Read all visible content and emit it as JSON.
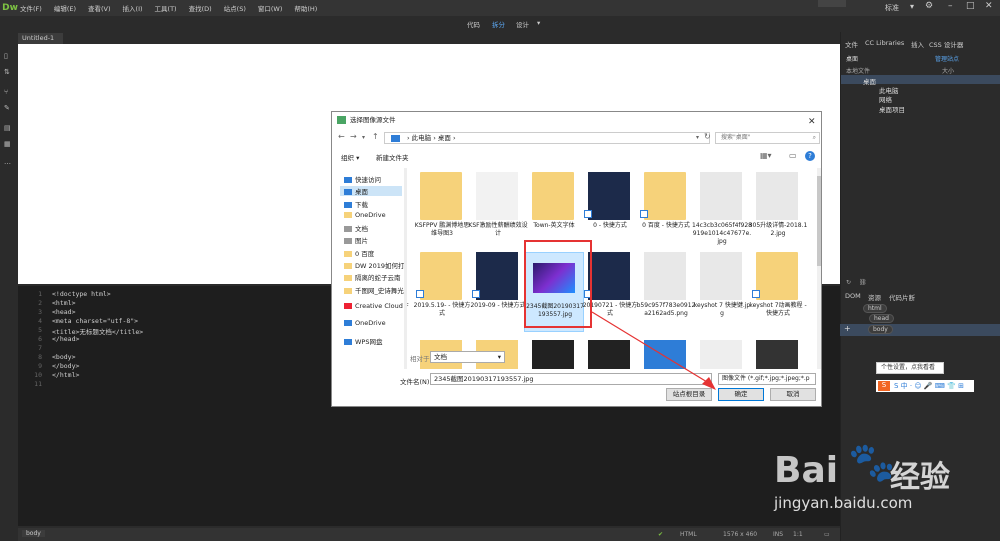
{
  "app": {
    "logo": "Dw",
    "menus": [
      "文件(F)",
      "编辑(E)",
      "查看(V)",
      "插入(I)",
      "工具(T)",
      "查找(D)",
      "站点(S)",
      "窗口(W)",
      "帮助(H)"
    ],
    "workspace": "标准",
    "view_buttons": [
      "代码",
      "拆分",
      "设计"
    ],
    "doc_tab": "Untitled-1",
    "doc_tab_close": "×"
  },
  "code": {
    "lines": [
      {
        "n": "1",
        "text": "<!doctype html>"
      },
      {
        "n": "2",
        "text": "<html>"
      },
      {
        "n": "3",
        "text": "<head>"
      },
      {
        "n": "4",
        "text": "<meta charset=\"utf-8\">"
      },
      {
        "n": "5",
        "text": "<title>无标题文档</title>"
      },
      {
        "n": "6",
        "text": "</head>"
      },
      {
        "n": "7",
        "text": ""
      },
      {
        "n": "8",
        "text": "<body>"
      },
      {
        "n": "9",
        "text": "</body>"
      },
      {
        "n": "10",
        "text": "</html>"
      },
      {
        "n": "11",
        "text": ""
      }
    ]
  },
  "statusbar": {
    "tag": "body",
    "lang": "HTML",
    "size": "1576 x 460",
    "mode": "INS",
    "pos": "1:1"
  },
  "rightpanel": {
    "tabs": [
      "文件",
      "CC Libraries",
      "插入",
      "CSS 设计器"
    ],
    "location": "桌面",
    "manage": "管理站点",
    "local_files": "本地文件",
    "size_col": "大小",
    "tree": [
      "桌面",
      "此电脑",
      "网络",
      "桌面项目"
    ],
    "dom_tabs": [
      "DOM",
      "资源",
      "代码片断"
    ],
    "dom_nodes": [
      "html",
      "head",
      "body"
    ]
  },
  "dialog": {
    "title": "选择图像源文件",
    "close": "✕",
    "breadcrumb": "› 此电脑 › 桌面 ›",
    "search_placeholder": "搜索\"桌面\"",
    "organize": "组织 ▾",
    "new_folder": "新建文件夹",
    "nav_items": [
      "快速访问",
      "桌面",
      "下载",
      "OneDrive",
      "文档",
      "图片",
      "0 百度",
      "DW 2019如何打",
      "隔离的蛇子云南",
      "千图网_史诗舞光",
      "Creative Cloud F",
      "OneDrive",
      "WPS网盘"
    ],
    "files": [
      {
        "label": "KSFPPV 鹏渊博地思维导图3"
      },
      {
        "label": "KSF激励性薪酬绩效设计"
      },
      {
        "label": "Town-英文字体"
      },
      {
        "label": "0 - 快捷方式"
      },
      {
        "label": "0 百度 - 快捷方式"
      },
      {
        "label": "14c3cb3c065f4f928919e1014c47677e.jpg"
      },
      {
        "label": "305升级详情-2018.12.jpg"
      },
      {
        "label": "2019.5.19- - 快捷方式"
      },
      {
        "label": "2019-09 - 快捷方式"
      },
      {
        "label": "2345截图20190317193557.jpg"
      },
      {
        "label": "20190721 - 快捷方式"
      },
      {
        "label": "b59c957f783e0912a2162ad5.png"
      },
      {
        "label": "keyshot 7 快捷键.jpg"
      },
      {
        "label": "keyshot 7动画教程 - 快捷方式"
      }
    ],
    "relative_to_label": "相对于:",
    "relative_to_value": "文档",
    "filename_label": "文件名(N):",
    "filename_value": "2345截图20190317193557.jpg",
    "filetype_value": "图像文件 (*.gif;*.jpg;*.jpeg;*.p",
    "site_root": "站点根目录",
    "ok": "确定",
    "cancel": "取消"
  },
  "ime": {
    "tooltip": "个性设置，点我看看",
    "bar": "S 中 · ☺ 🎤 ⌨ 👕 ⊞"
  },
  "watermark": {
    "brand": "Bai",
    "brand2": "经验",
    "url": "jingyan.baidu.com"
  }
}
